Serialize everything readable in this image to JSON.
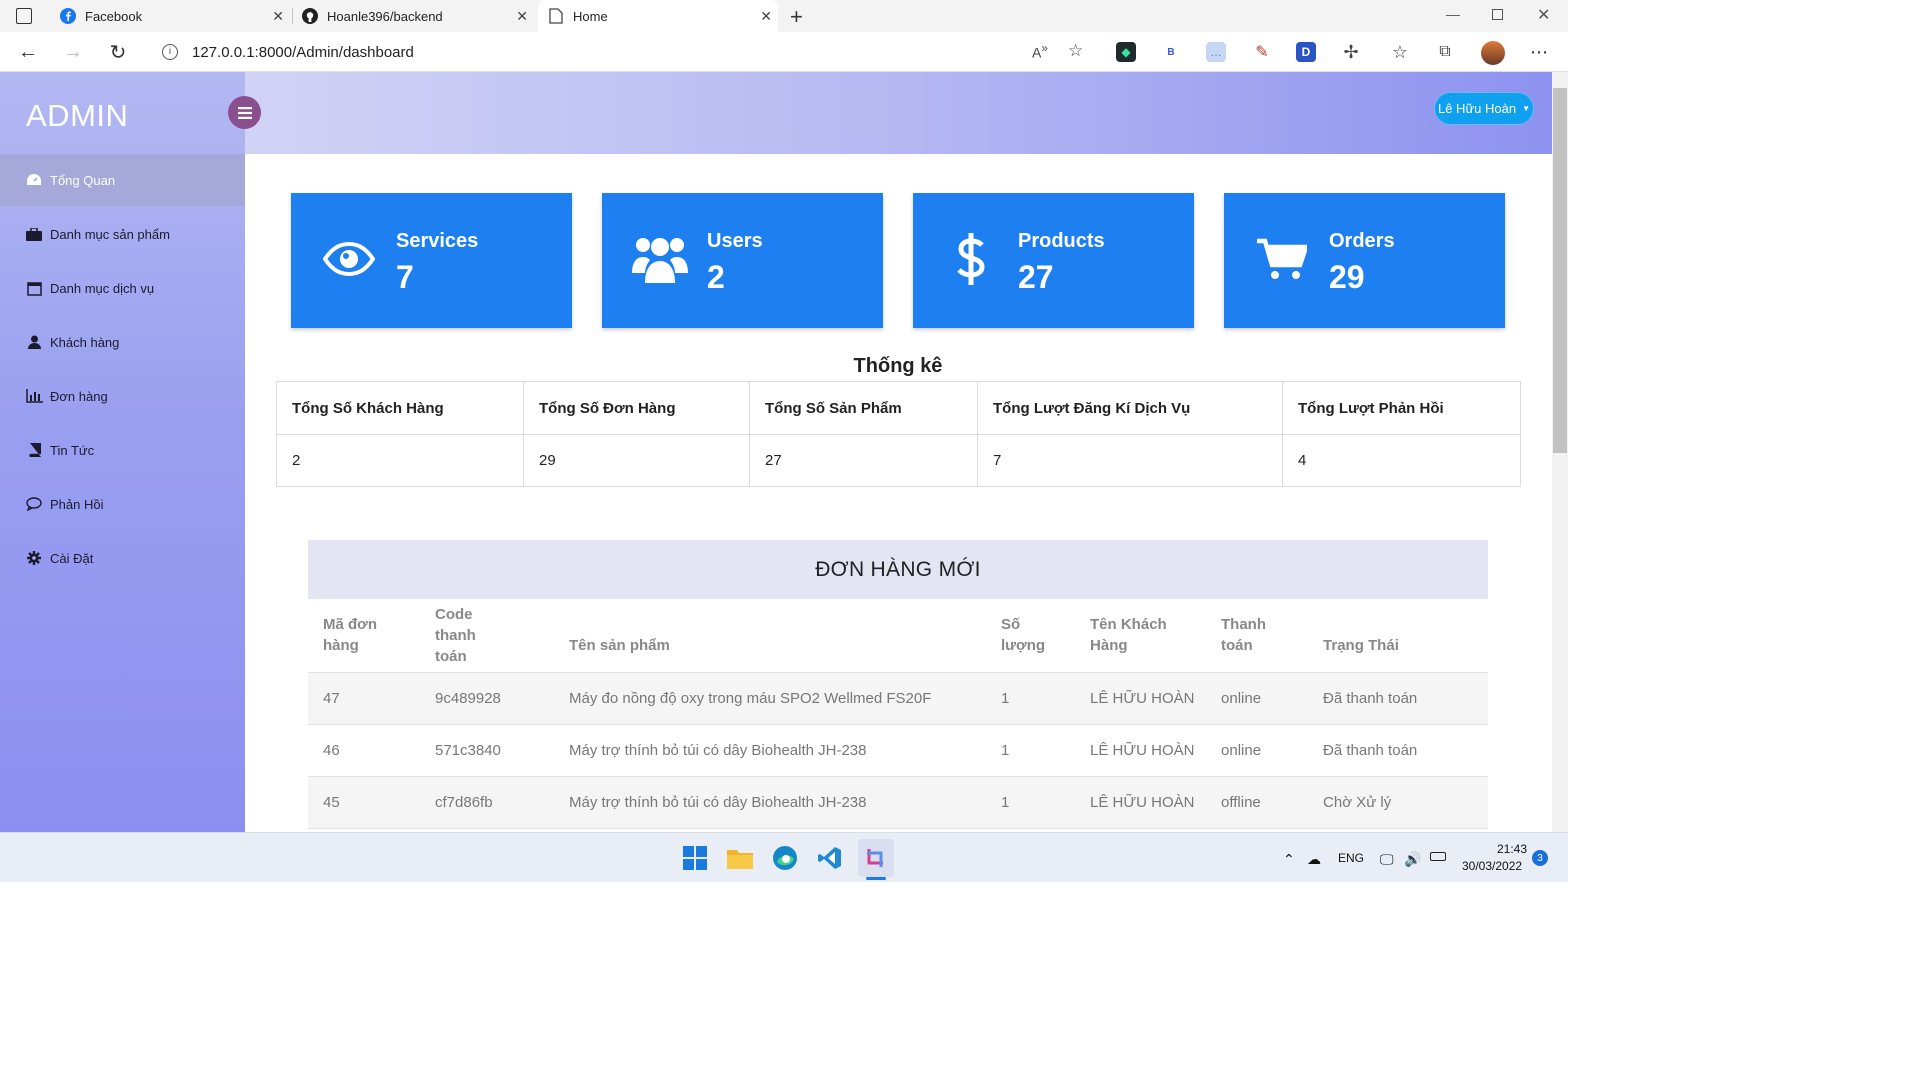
{
  "browser": {
    "tabs": [
      {
        "title": "Facebook",
        "icon": "facebook-icon"
      },
      {
        "title": "Hoanle396/backend",
        "icon": "github-icon"
      },
      {
        "title": "Home",
        "icon": "page-icon",
        "active": true
      }
    ],
    "url": "127.0.0.1:8000/Admin/dashboard",
    "extensions": [
      {
        "name": "ext-green-icon",
        "text": "◆"
      },
      {
        "name": "ext-b-icon",
        "text": "B"
      },
      {
        "name": "ext-chat-icon",
        "text": "…"
      },
      {
        "name": "ext-picker-icon",
        "text": "✎"
      },
      {
        "name": "ext-d-icon",
        "text": "D"
      }
    ]
  },
  "sidebar": {
    "brand": "ADMIN",
    "items": [
      {
        "label": "Tổng Quan",
        "icon": "dashboard-icon",
        "active": true
      },
      {
        "label": "Danh mục sản phẩm",
        "icon": "briefcase-icon"
      },
      {
        "label": "Danh mục dịch vụ",
        "icon": "calendar-icon"
      },
      {
        "label": "Khách hàng",
        "icon": "user-icon"
      },
      {
        "label": "Đơn hàng",
        "icon": "bar-chart-icon"
      },
      {
        "label": "Tin Tức",
        "icon": "book-icon"
      },
      {
        "label": "Phản Hồi",
        "icon": "comment-icon"
      },
      {
        "label": "Cài Đặt",
        "icon": "gear-icon"
      }
    ]
  },
  "header": {
    "user_name": "Lê Hữu Hoàn"
  },
  "cards": [
    {
      "label": "Services",
      "value": "7",
      "icon": "eye-icon"
    },
    {
      "label": "Users",
      "value": "2",
      "icon": "users-icon"
    },
    {
      "label": "Products",
      "value": "27",
      "icon": "dollar-icon"
    },
    {
      "label": "Orders",
      "value": "29",
      "icon": "cart-icon"
    }
  ],
  "stats": {
    "title": "Thống kê",
    "headers": [
      "Tổng Số Khách Hàng",
      "Tổng Số Đơn Hàng",
      "Tổng Số Sản Phẩm",
      "Tổng Lượt Đăng Kí Dịch Vụ",
      "Tổng Lượt Phản Hồi"
    ],
    "values": [
      "2",
      "29",
      "27",
      "7",
      "4"
    ]
  },
  "orders": {
    "title": "ĐƠN HÀNG MỚI",
    "headers": [
      "Mã đơn hàng",
      "Code thanh toán",
      "Tên sản phẩm",
      "Số lượng",
      "Tên Khách Hàng",
      "Thanh toán",
      "Trạng Thái"
    ],
    "rows": [
      [
        "47",
        "9c489928",
        "Máy đo nồng độ oxy trong máu SPO2 Wellmed FS20F",
        "1",
        "LÊ HỮU HOÀN",
        "online",
        "Đã thanh toán"
      ],
      [
        "46",
        "571c3840",
        "Máy trợ thính bỏ túi có dây Biohealth JH-238",
        "1",
        "LÊ HỮU HOÀN",
        "online",
        "Đã thanh toán"
      ],
      [
        "45",
        "cf7d86fb",
        "Máy trợ thính bỏ túi có dây Biohealth JH-238",
        "1",
        "LÊ HỮU HOÀN",
        "offline",
        "Chờ Xử lý"
      ]
    ]
  },
  "taskbar": {
    "language": "ENG",
    "time": "21:43",
    "date": "30/03/2022",
    "notifications": "3"
  }
}
